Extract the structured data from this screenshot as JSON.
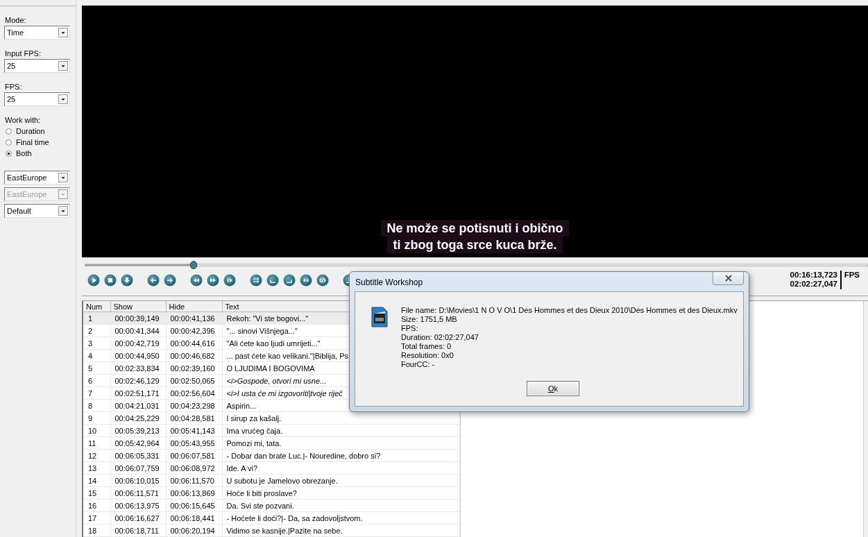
{
  "sidebar": {
    "fields": [
      {
        "kind": "dropdown",
        "label": "Mode:",
        "value": "Time",
        "disabled": false
      },
      {
        "kind": "dropdown",
        "label": "Input FPS:",
        "value": "25",
        "disabled": false
      },
      {
        "kind": "dropdown",
        "label": "FPS:",
        "value": "25",
        "disabled": false
      },
      {
        "kind": "radios",
        "label": "Work with:",
        "options": [
          {
            "label": "Duration",
            "selected": false
          },
          {
            "label": "Final time",
            "selected": false
          },
          {
            "label": "Both",
            "selected": true
          }
        ]
      },
      {
        "kind": "dropdown",
        "value": "EastEurope",
        "disabled": false
      },
      {
        "kind": "dropdown",
        "value": "EastEurope",
        "disabled": true
      },
      {
        "kind": "dropdown",
        "value": "Default",
        "disabled": false
      }
    ]
  },
  "video": {
    "subtitle_lines": [
      "Ne može se potisnuti i obično",
      "ti zbog toga srce kuca brže."
    ]
  },
  "seek": {
    "level": 0.138
  },
  "time": {
    "current": "00:16:13,723",
    "total": "02:02:27,047",
    "fps_label": "FPS"
  },
  "table": {
    "columns": [
      "Num",
      "Show",
      "Hide",
      "Text"
    ],
    "rows": [
      {
        "num": "1",
        "show": "00:00:39,149",
        "hide": "00:00:41,136",
        "text": "Rekoh: \"Vi ste bogovi...\"",
        "italic": false,
        "selected": true
      },
      {
        "num": "2",
        "show": "00:00:41,344",
        "hide": "00:00:42,396",
        "text": "\"... sinovi Višnjega...\"",
        "italic": false,
        "selected": false
      },
      {
        "num": "3",
        "show": "00:00:42,719",
        "hide": "00:00:44,616",
        "text": "\"Ali ćete kao ljudi umrijeti...\"",
        "italic": false,
        "selected": false
      },
      {
        "num": "4",
        "show": "00:00:44,950",
        "hide": "00:00:46,682",
        "text": "... past ćete kao velikani.\"|Biblija, Ps",
        "italic": false,
        "selected": false
      },
      {
        "num": "5",
        "show": "00:02:33,834",
        "hide": "00:02:39,160",
        "text": "O LJUDIMA I BOGOVIMA",
        "italic": false,
        "selected": false
      },
      {
        "num": "6",
        "show": "00:02:46,129",
        "hide": "00:02:50,065",
        "text": "<i>Gospode, otvori mi usne...",
        "italic": true,
        "selected": false
      },
      {
        "num": "7",
        "show": "00:02:51,171",
        "hide": "00:02:56,604",
        "text": "<i>I usta će mi izgovoriti|tvoje riječ",
        "italic": true,
        "selected": false
      },
      {
        "num": "8",
        "show": "00:04:21,031",
        "hide": "00:04:23,298",
        "text": "Aspirin...",
        "italic": false,
        "selected": false
      },
      {
        "num": "9",
        "show": "00:04:25,229",
        "hide": "00:04:28,581",
        "text": "I sirup za kašalj.",
        "italic": false,
        "selected": false
      },
      {
        "num": "10",
        "show": "00:05:39,213",
        "hide": "00:05:41,143",
        "text": "Ima vrućeg čaja.",
        "italic": false,
        "selected": false
      },
      {
        "num": "11",
        "show": "00:05:42,964",
        "hide": "00:05:43,955",
        "text": "Pomozi mi, tata.",
        "italic": false,
        "selected": false
      },
      {
        "num": "12",
        "show": "00:06:05,331",
        "hide": "00:06:07,581",
        "text": "- Dobar dan brate Luc.|- Nouredine, dobro si?",
        "italic": false,
        "selected": false
      },
      {
        "num": "13",
        "show": "00:06:07,759",
        "hide": "00:06:08,972",
        "text": "Ide. A vi?",
        "italic": false,
        "selected": false
      },
      {
        "num": "14",
        "show": "00:06:10,015",
        "hide": "00:06:11,570",
        "text": "U subotu je Jamelovo obrezanje.",
        "italic": false,
        "selected": false
      },
      {
        "num": "15",
        "show": "00:06:11,571",
        "hide": "00:06:13,869",
        "text": "Hoće li biti proslave?",
        "italic": false,
        "selected": false
      },
      {
        "num": "16",
        "show": "00:06:13,975",
        "hide": "00:06:15,645",
        "text": "Da. Svi ste pozvani.",
        "italic": false,
        "selected": false
      },
      {
        "num": "17",
        "show": "00:06:16,627",
        "hide": "00:06:18,441",
        "text": "- Hoćete li doći?|- Da, sa zadovoljstvom.",
        "italic": false,
        "selected": false
      },
      {
        "num": "18",
        "show": "00:06:18,711",
        "hide": "00:06:20,194",
        "text": "Vidimo se kasnije.|Pazite na sebe.",
        "italic": false,
        "selected": false
      }
    ]
  },
  "dialog": {
    "title": "Subtitle Workshop",
    "lines": [
      "File name: D:\\Movies\\1 N O V O\\1 Des Hommes et des Dieux 2010\\Des Hommes et des Dieux.mkv",
      "Size: 1751,5 MB",
      "FPS:",
      "Duration: 02:02:27,047",
      "Total frames: 0",
      "Resolution: 0x0",
      "FourCC: -"
    ],
    "button": "Ok"
  }
}
